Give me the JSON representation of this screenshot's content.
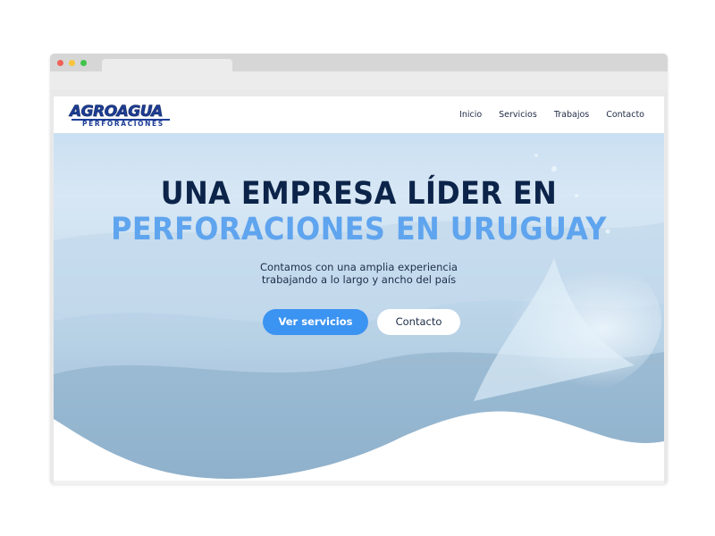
{
  "site": {
    "logo": {
      "main": "AGROAGUA",
      "sub": "PERFORACIONES"
    },
    "nav": [
      {
        "label": "Inicio"
      },
      {
        "label": "Servicios"
      },
      {
        "label": "Trabajos"
      },
      {
        "label": "Contacto"
      }
    ]
  },
  "hero": {
    "title_line1": "UNA EMPRESA LÍDER EN",
    "title_line2": "PERFORACIONES EN URUGUAY",
    "subtitle_line1": "Contamos con una amplia experiencia",
    "subtitle_line2": "trabajando a lo largo y ancho del país",
    "primary_button": "Ver servicios",
    "secondary_button": "Contacto"
  },
  "colors": {
    "title_dark": "#0c2449",
    "title_accent": "#5fa4ee",
    "button_primary": "#3b93f2",
    "logo_blue": "#1d3e97"
  }
}
